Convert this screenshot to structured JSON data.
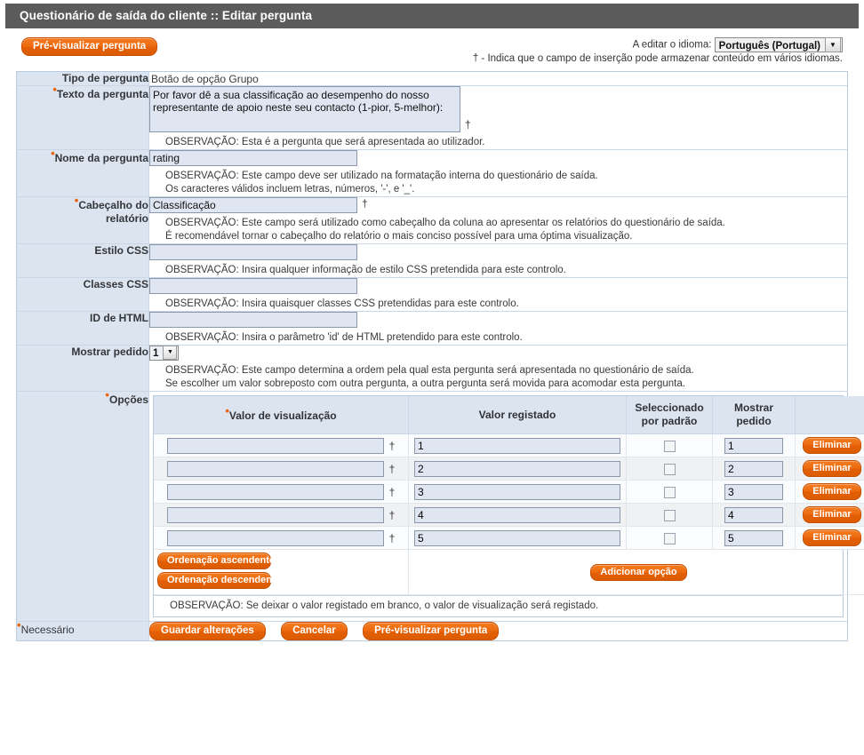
{
  "window": {
    "title": "Questionário de saída do cliente :: Editar pergunta"
  },
  "toolbar": {
    "preview_label": "Pré-visualizar pergunta",
    "language_label": "A editar o idioma:",
    "language_value": "Português (Portugal)",
    "dagger_note": "† - Indica que o campo de inserção pode armazenar conteúdo em vários idiomas.",
    "dropdown_arrow": "▼"
  },
  "form": {
    "question_type": {
      "label": "Tipo de pergunta",
      "value": "Botão de opção Grupo"
    },
    "question_text": {
      "label": "Texto da pergunta",
      "required": true,
      "value": "Por favor dê a sua classificação ao desempenho do nosso representante de apoio neste seu contacto (1-pior, 5-melhor):",
      "dagger": "†",
      "note": "OBSERVAÇÃO: Esta é a pergunta que será apresentada ao utilizador."
    },
    "question_name": {
      "label": "Nome da pergunta",
      "required": true,
      "value": "rating",
      "note_line1": "OBSERVAÇÃO: Este campo deve ser utilizado na formatação interna do questionário de saída.",
      "note_line2": "Os caracteres válidos incluem letras, números, '-', e '_'."
    },
    "report_header": {
      "label_line1": "Cabeçalho do",
      "label_line2": "relatório",
      "required": true,
      "value": "Classificação",
      "dagger": "†",
      "note_line1": "OBSERVAÇÃO: Este campo será utilizado como cabeçalho da coluna ao apresentar os relatórios do questionário de saída.",
      "note_line2": "É recomendável tornar o cabeçalho do relatório o mais conciso possível para uma óptima visualização."
    },
    "css_style": {
      "label": "Estilo CSS",
      "value": "",
      "note": "OBSERVAÇÃO: Insira qualquer informação de estilo CSS pretendida para este controlo."
    },
    "css_classes": {
      "label": "Classes CSS",
      "value": "",
      "note": "OBSERVAÇÃO: Insira quaisquer classes CSS pretendidas para este controlo."
    },
    "html_id": {
      "label": "ID de HTML",
      "value": "",
      "note": "OBSERVAÇÃO: Insira o parâmetro 'id' de HTML pretendido para este controlo."
    },
    "display_order": {
      "label": "Mostrar pedido",
      "value": "1",
      "options": [
        "1"
      ],
      "note_line1": "OBSERVAÇÃO: Este campo determina a ordem pela qual esta pergunta será apresentada no questionário de saída.",
      "note_line2": "Se escolher um valor sobreposto com outra pergunta, a outra pergunta será movida para acomodar esta pergunta."
    },
    "options": {
      "label": "Opções",
      "required": true,
      "columns": {
        "display_value": "Valor de visualização",
        "display_value_required": true,
        "stored_value": "Valor registado",
        "selected_by_default_line1": "Seleccionado",
        "selected_by_default_line2": "por padrão",
        "display_order_line1": "Mostrar",
        "display_order_line2": "pedido",
        "actions": ""
      },
      "rows": [
        {
          "display_value": "",
          "dagger": "†",
          "stored_value": "1",
          "selected": false,
          "order": "1",
          "delete_label": "Eliminar"
        },
        {
          "display_value": "",
          "dagger": "†",
          "stored_value": "2",
          "selected": false,
          "order": "2",
          "delete_label": "Eliminar"
        },
        {
          "display_value": "",
          "dagger": "†",
          "stored_value": "3",
          "selected": false,
          "order": "3",
          "delete_label": "Eliminar"
        },
        {
          "display_value": "",
          "dagger": "†",
          "stored_value": "4",
          "selected": false,
          "order": "4",
          "delete_label": "Eliminar"
        },
        {
          "display_value": "",
          "dagger": "†",
          "stored_value": "5",
          "selected": false,
          "order": "5",
          "delete_label": "Eliminar"
        }
      ],
      "sort_ascending_label": "Ordenação ascendente",
      "sort_descending_label": "Ordenação descendente",
      "add_option_label": "Adicionar opção",
      "footer_note": "OBSERVAÇÃO: Se deixar o valor registado em branco, o valor de visualização será registado."
    }
  },
  "footer": {
    "required_legend": "Necessário",
    "save_label": "Guardar alterações",
    "cancel_label": "Cancelar",
    "preview_label": "Pré-visualizar pergunta"
  },
  "colors": {
    "titlebar_bg": "#5b5b5b",
    "accent_orange": "#e8640a",
    "label_bg": "#dce4ef",
    "input_bg": "#dfe6f2",
    "border_blue": "#b9cbe0"
  }
}
